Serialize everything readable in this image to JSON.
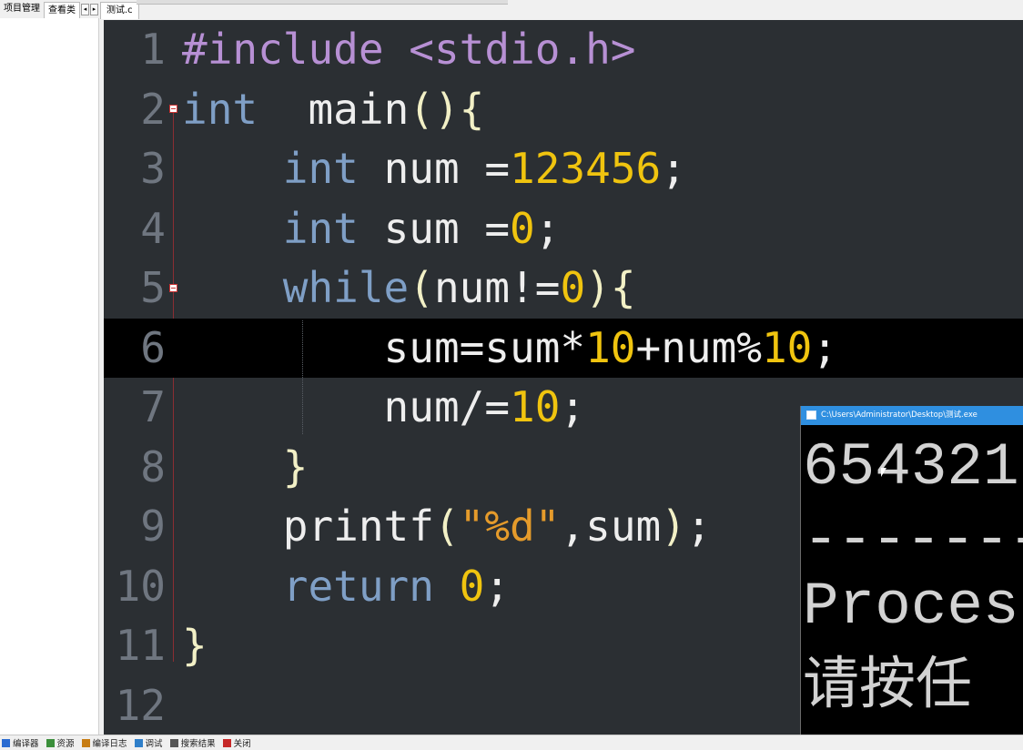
{
  "top_tabs": {
    "project": "项目管理",
    "classes": "查看类",
    "file": "测试.c",
    "arrow_left": "◂",
    "arrow_right": "▸"
  },
  "editor": {
    "lines": [
      {
        "n": "1",
        "tokens": [
          [
            "pp",
            "#include "
          ],
          [
            "pp",
            "<stdio.h>"
          ]
        ]
      },
      {
        "n": "2",
        "tokens": [
          [
            "kw",
            "int"
          ],
          [
            "",
            "  main"
          ],
          [
            "br",
            "()"
          ],
          [
            "br",
            "{"
          ]
        ]
      },
      {
        "n": "3",
        "tokens": [
          [
            "",
            "    "
          ],
          [
            "kw",
            "int"
          ],
          [
            "",
            " num ="
          ],
          [
            "num",
            "123456"
          ],
          [
            "",
            ";"
          ]
        ]
      },
      {
        "n": "4",
        "tokens": [
          [
            "",
            "    "
          ],
          [
            "kw",
            "int"
          ],
          [
            "",
            " sum ="
          ],
          [
            "num",
            "0"
          ],
          [
            "",
            ";"
          ]
        ]
      },
      {
        "n": "5",
        "tokens": [
          [
            "",
            "    "
          ],
          [
            "kw",
            "while"
          ],
          [
            "br",
            "("
          ],
          [
            "",
            "num!="
          ],
          [
            "num",
            "0"
          ],
          [
            "br",
            ")"
          ],
          [
            "br",
            "{"
          ]
        ]
      },
      {
        "n": "6",
        "tokens": [
          [
            "",
            "        sum=sum*"
          ],
          [
            "num",
            "10"
          ],
          [
            "",
            "+num%"
          ],
          [
            "num",
            "10"
          ],
          [
            "",
            ";"
          ]
        ]
      },
      {
        "n": "7",
        "tokens": [
          [
            "",
            "        num/="
          ],
          [
            "num",
            "10"
          ],
          [
            "",
            ";"
          ]
        ]
      },
      {
        "n": "8",
        "tokens": [
          [
            "",
            "    "
          ],
          [
            "br",
            "}"
          ]
        ]
      },
      {
        "n": "9",
        "tokens": [
          [
            "",
            "    printf"
          ],
          [
            "br",
            "("
          ],
          [
            "str",
            "\"%d\""
          ],
          [
            "",
            ",sum"
          ],
          [
            "br",
            ")"
          ],
          [
            "",
            ";"
          ]
        ]
      },
      {
        "n": "10",
        "tokens": [
          [
            "",
            "    "
          ],
          [
            "kw",
            "return"
          ],
          [
            "",
            " "
          ],
          [
            "num",
            "0"
          ],
          [
            "",
            ";"
          ]
        ]
      },
      {
        "n": "11",
        "tokens": [
          [
            "br",
            "}"
          ]
        ]
      },
      {
        "n": "12",
        "tokens": []
      }
    ],
    "current_line": 6
  },
  "console": {
    "title": "C:\\Users\\Administrator\\Desktop\\测试.exe",
    "output_lines": [
      "654321",
      "-------",
      "",
      "Proces",
      "请按任"
    ]
  },
  "bottom_tabs": [
    {
      "label": "编译器",
      "icon": "compiler-icon",
      "color": "#2a6bd1"
    },
    {
      "label": "资源",
      "icon": "resources-icon",
      "color": "#3b8f3b"
    },
    {
      "label": "编译日志",
      "icon": "compile-log-icon",
      "color": "#c77d14"
    },
    {
      "label": "调试",
      "icon": "debug-icon",
      "color": "#2f7fc9"
    },
    {
      "label": "搜索结果",
      "icon": "search-results-icon",
      "color": "#555555"
    },
    {
      "label": "关闭",
      "icon": "close-icon",
      "color": "#c62828"
    }
  ],
  "colors": {
    "editor_bg": "#2b2f33",
    "keyword": "#7f9fc6",
    "preprocessor": "#b790d4",
    "number": "#f0c40f",
    "string": "#e59b2b",
    "console_title_bg": "#2f8fe0"
  }
}
